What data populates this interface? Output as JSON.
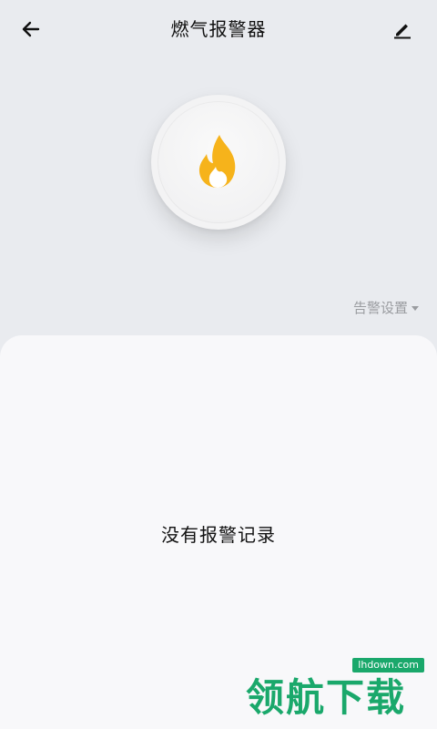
{
  "header": {
    "title": "燃气报警器",
    "back_icon": "arrow-left-icon",
    "edit_icon": "pencil-icon"
  },
  "device": {
    "icon": "flame-icon",
    "flame_outer_color": "#f6b31b",
    "flame_inner_color": "#ffffff"
  },
  "alarm_settings": {
    "label": "告警设置",
    "icon": "caret-down-icon"
  },
  "records": {
    "empty_text": "没有报警记录"
  },
  "watermark": {
    "url": "lhdown.com",
    "text": "领航下载",
    "color": "#1aa86b"
  }
}
